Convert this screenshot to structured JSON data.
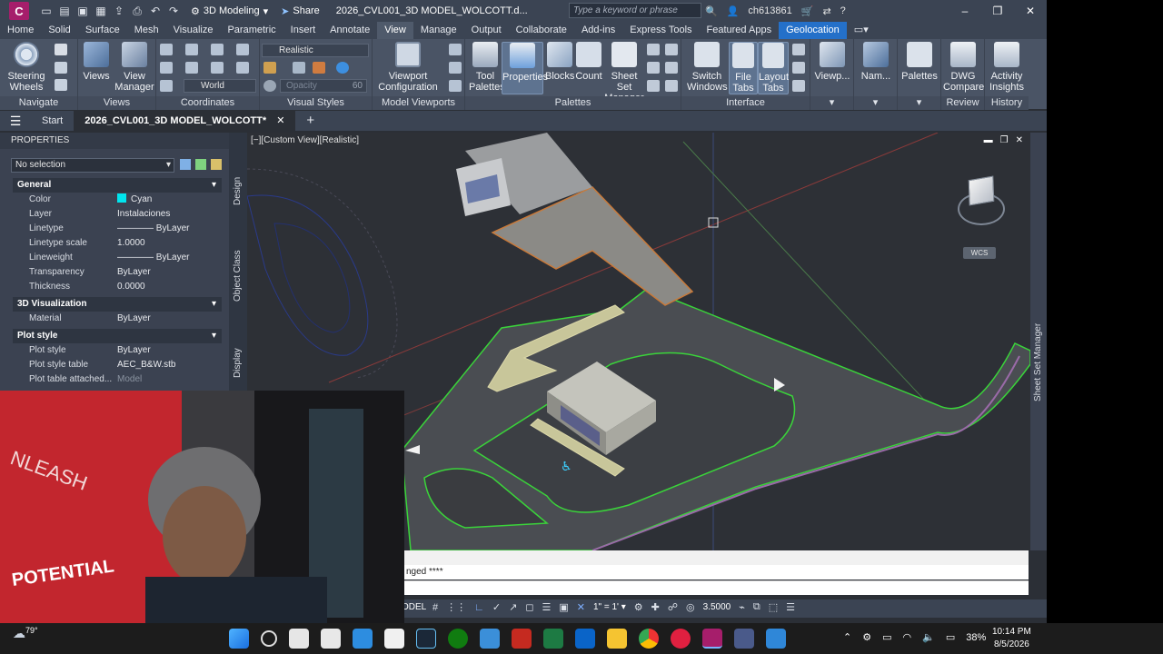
{
  "titlebar": {
    "app_logo": "C",
    "workspace": "3D Modeling",
    "share_label": "Share",
    "doc_title": "2026_CVL001_3D MODEL_WOLCOTT.d...",
    "search_placeholder": "Type a keyword or phrase",
    "user": "ch613861"
  },
  "menu_tabs": [
    "Home",
    "Solid",
    "Surface",
    "Mesh",
    "Visualize",
    "Parametric",
    "Insert",
    "Annotate",
    "View",
    "Manage",
    "Output",
    "Collaborate",
    "Add-ins",
    "Express Tools",
    "Featured Apps",
    "Geolocation"
  ],
  "ribbon": {
    "navigate": {
      "label": "Navigate",
      "steering": "Steering Wheels"
    },
    "views": {
      "label": "Views",
      "views_btn": "Views",
      "view_manager": "View Manager"
    },
    "coordinates": {
      "label": "Coordinates",
      "world": "World"
    },
    "visual_styles": {
      "label": "Visual Styles",
      "style": "Realistic",
      "opacity_label": "Opacity",
      "opacity_value": "60"
    },
    "model_viewports": {
      "label": "Model Viewports",
      "viewport_config": "Viewport Configuration"
    },
    "palettes": {
      "label": "Palettes",
      "tool_palettes": "Tool Palettes",
      "properties": "Properties",
      "blocks": "Blocks",
      "count": "Count",
      "sheet_set_manager": "Sheet Set Manager"
    },
    "interface": {
      "label": "Interface",
      "switch_windows": "Switch Windows",
      "file_tabs": "File Tabs",
      "layout_tabs": "Layout Tabs"
    },
    "extra": {
      "viewp": "Viewp...",
      "nam": "Nam...",
      "palettes_btn": "Palettes"
    },
    "review": {
      "label": "Review",
      "dwg_compare": "DWG Compare"
    },
    "history": {
      "label": "History",
      "activity_insights": "Activity Insights"
    }
  },
  "file_tabs": {
    "start": "Start",
    "active": "2026_CVL001_3D MODEL_WOLCOTT*"
  },
  "properties": {
    "title": "PROPERTIES",
    "selection": "No selection",
    "side_tabs": [
      "Design",
      "Object Class",
      "Display"
    ],
    "general": {
      "title": "General",
      "rows": [
        {
          "key": "Color",
          "value": "Cyan"
        },
        {
          "key": "Layer",
          "value": "Instalaciones"
        },
        {
          "key": "Linetype",
          "value": "ByLayer"
        },
        {
          "key": "Linetype scale",
          "value": "1.0000"
        },
        {
          "key": "Lineweight",
          "value": "ByLayer"
        },
        {
          "key": "Transparency",
          "value": "ByLayer"
        },
        {
          "key": "Thickness",
          "value": "0.0000"
        }
      ]
    },
    "viz3d": {
      "title": "3D Visualization",
      "rows": [
        {
          "key": "Material",
          "value": "ByLayer"
        }
      ]
    },
    "plot": {
      "title": "Plot style",
      "rows": [
        {
          "key": "Plot style",
          "value": "ByLayer"
        },
        {
          "key": "Plot style table",
          "value": "AEC_B&W.stb"
        },
        {
          "key": "Plot table attached...",
          "value": "Model"
        }
      ]
    }
  },
  "viewport": {
    "label": "[−][Custom View][Realistic]",
    "wcs": "WCS",
    "sheet_set_manager": "Sheet Set Manager"
  },
  "command": {
    "line": "nged ****"
  },
  "statusbar": {
    "model": "ODEL",
    "scale": "1\" = 1'",
    "value": "3.5000"
  },
  "colors": {
    "accent": "#2470c9",
    "cyan": "#00e5ee",
    "ribbon": "#4a5465",
    "curb_green": "#3ad43a"
  },
  "taskbar": {
    "weather": "79°",
    "battery": "38%",
    "time": "10:14 PM",
    "date": "8/5/2026"
  }
}
